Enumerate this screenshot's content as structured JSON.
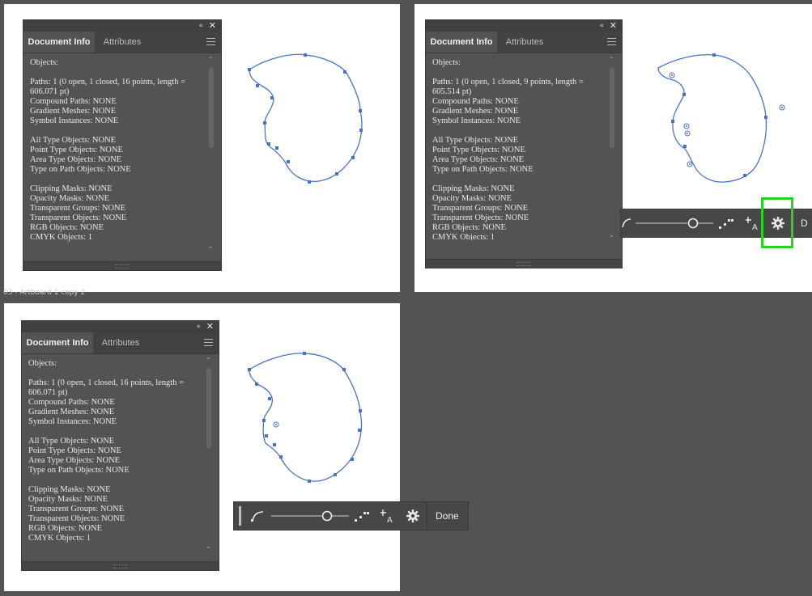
{
  "artboard_label": "03 - Artboard 1 copy 2",
  "panel": {
    "tab_active": "Document Info",
    "tab_inactive": "Attributes",
    "collapse_icon": "double-chevron-left-icon",
    "close_icon": "close-icon",
    "menu_icon": "panel-menu-icon"
  },
  "doc_info_a": [
    "Objects:",
    "",
    "Paths: 1 (0 open, 1 closed, 16 points, length =",
    "606.071 pt)",
    "Compound Paths: NONE",
    "Gradient Meshes: NONE",
    "Symbol Instances: NONE",
    "",
    "All Type Objects: NONE",
    "Point Type Objects: NONE",
    "Area Type Objects: NONE",
    "Type on Path Objects: NONE",
    "",
    "Clipping Masks: NONE",
    "Opacity Masks: NONE",
    "Transparent Groups: NONE",
    "Transparent Objects: NONE",
    "RGB Objects: NONE",
    "CMYK Objects: 1"
  ],
  "doc_info_b": [
    "Objects:",
    "",
    "Paths: 1 (0 open, 1 closed, 9 points, length =",
    "605.514 pt)",
    "Compound Paths: NONE",
    "Gradient Meshes: NONE",
    "Symbol Instances: NONE",
    "",
    "All Type Objects: NONE",
    "Point Type Objects: NONE",
    "Area Type Objects: NONE",
    "Type on Path Objects: NONE",
    "",
    "Clipping Masks: NONE",
    "Opacity Masks: NONE",
    "Transparent Groups: NONE",
    "Transparent Objects: NONE",
    "RGB Objects: NONE",
    "CMYK Objects: 1"
  ],
  "toolbar": {
    "done_label": "Done",
    "done_label_cropped": "D",
    "icons": [
      "curvature-icon",
      "simplify-slider-icon",
      "auto-smooth-icon",
      "direct-select-anchor-icon",
      "settings-gear-icon"
    ]
  },
  "colors": {
    "workspace": "#535353",
    "panel_bg": "#535353",
    "path_stroke": "#4a72c4",
    "highlight": "#27d51c"
  }
}
